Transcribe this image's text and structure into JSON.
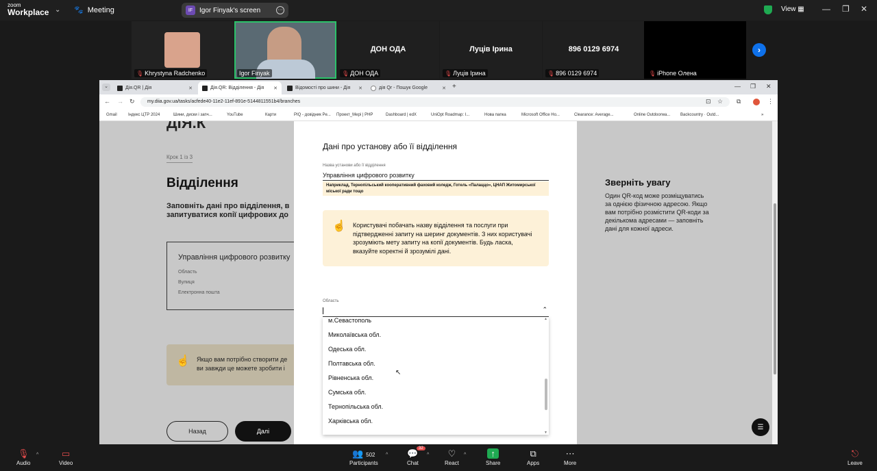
{
  "zoom": {
    "logo_top": "zoom",
    "logo_bottom": "Workplace",
    "meeting_label": "Meeting",
    "share_initials": "IF",
    "share_label": "Igor Finyak's screen",
    "view_label": "View",
    "participants_tiles": [
      {
        "name": "Khrystyna Radchenko",
        "big": "",
        "muted": true
      },
      {
        "name": "Igor Finyak",
        "big": "",
        "muted": false
      },
      {
        "name": "ДОН ОДА",
        "big": "ДОН ОДА",
        "muted": true
      },
      {
        "name": "Луців Ірина",
        "big": "Луців Ірина",
        "muted": true
      },
      {
        "name": "896 0129 6974",
        "big": "896 0129 6974",
        "muted": true
      },
      {
        "name": "iPhone Олена",
        "big": "",
        "muted": true
      }
    ],
    "bottom": {
      "audio": "Audio",
      "video": "Video",
      "participants": "Participants",
      "participants_count": "502",
      "chat": "Chat",
      "chat_badge": "32",
      "react": "React",
      "share": "Share",
      "apps": "Apps",
      "more": "More",
      "leave": "Leave"
    }
  },
  "browser": {
    "tabs": [
      {
        "label": "Дія.QR | Дія",
        "active": false
      },
      {
        "label": "Дія.QR: Відділення - Дія",
        "active": true
      },
      {
        "label": "Відомості про шини - Дія",
        "active": false
      },
      {
        "label": "дія Qr - Пошук Google",
        "active": false
      }
    ],
    "url": "my.diia.gov.ua/tasks/acfede40-11e2-11ef-891e-5144811551b4/branches",
    "bookmarks": [
      "Gmail",
      "Індекс ЦТР 2024",
      "Шини, диски і запч...",
      "YouTube",
      "Карти",
      "PIQ - довідник Pe...",
      "Проект_Мері | PHP",
      "Dashboard | edX",
      "UniOpt Roadmap: І...",
      "Нова папка",
      "Microsoft Office Ho...",
      "Clearance: Average...",
      "Online Outdoorwa...",
      "Backcountry · Outd..."
    ]
  },
  "page": {
    "step": "Крок 1 із 3",
    "title": "Відділення",
    "description_line1": "Заповніть дані про відділення, в",
    "description_line2": "запитуватися копії цифрових до",
    "card_title": "Управління цифрового розвитку",
    "card_fields": [
      "Область",
      "Вулиця",
      "Електронна пошта"
    ],
    "hint_line1": "Якщо вам потрібно створити де",
    "hint_line2": "ви завжди це можете зробити і",
    "back_button": "Назад",
    "next_button": "Далі",
    "attention_title": "Зверніть увагу",
    "attention_text": "Один QR-код може розміщуватись\nза однією фізичною адресою. Якщо\nвам потрібно розмістити QR-коди за\nдекількома адресами — заповніть\nдані для кожної адреси."
  },
  "modal": {
    "title": "Дані про установу або її відділення",
    "name_label": "Назва установи або її відділення",
    "name_value": "Управління цифрового розвитку",
    "example": "Наприклад, Тернопільський кооперативний фаховий коледж, Готель «Палаццо», ЦНАП Житомирської міської ради тощо",
    "note": "Користувачі побачать назву відділення та послуги при підтвердженні запиту на шеринг документів. З них користувачі зрозуміють мету запиту на копії документів. Будь ласка, вказуйте коректні й зрозумілі дані.",
    "region_label": "Область",
    "region_value": "",
    "options": [
      "м.Севастополь",
      "Миколаївська обл.",
      "Одеська обл.",
      "Полтавська обл.",
      "Рівненська обл.",
      "Сумська обл.",
      "Тернопільська обл.",
      "Харківська обл."
    ]
  },
  "colors": {
    "zoom_green": "#2bc36a",
    "zoom_blue": "#0e71eb",
    "mute_red": "#e24b4b",
    "hint_bg": "#fdf1d8"
  },
  "icons": [
    "mic-muted-icon",
    "video-off-icon",
    "participants-icon",
    "chat-icon",
    "react-icon",
    "share-icon",
    "apps-icon",
    "more-icon",
    "leave-icon",
    "shield-icon",
    "hand-pointing-icon",
    "chevron-up-icon"
  ]
}
